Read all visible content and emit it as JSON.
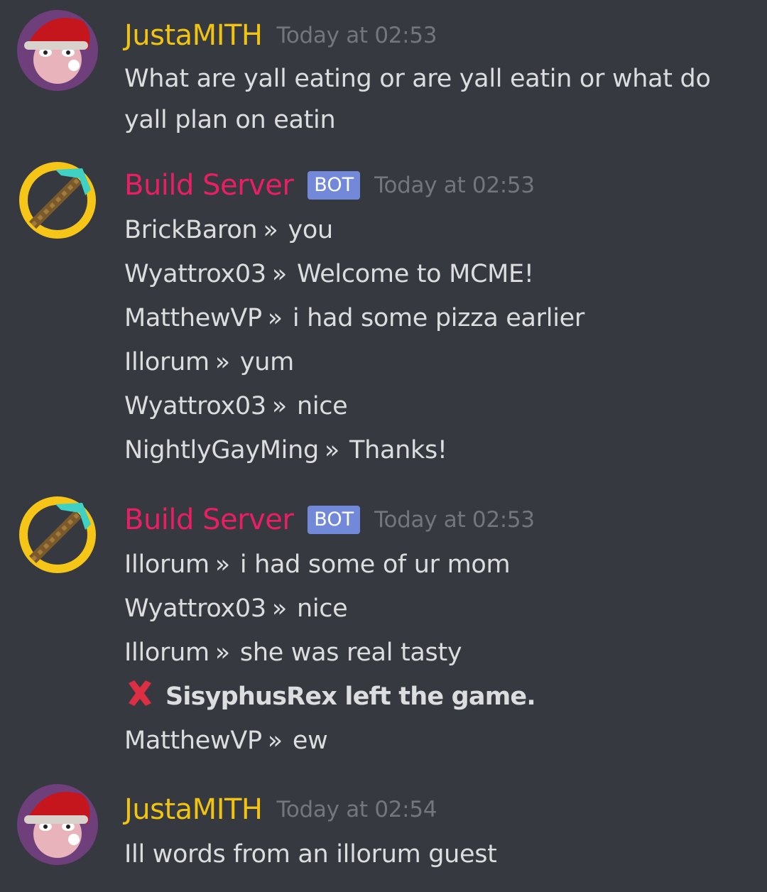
{
  "messages": [
    {
      "author": "JustaMITH",
      "author_color": "#f1c40f",
      "timestamp": "Today at 02:53",
      "avatar_icon": "santa-hat-avatar",
      "text": "What are yall eating or are yall eatin or what do yall plan on eatin"
    },
    {
      "author": "Build Server",
      "author_color": "#e91e63",
      "badge": "BOT",
      "timestamp": "Today at 02:53",
      "avatar_icon": "pickaxe-avatar",
      "lines": [
        {
          "user": "BrickBaron",
          "sep": "»",
          "text": "you"
        },
        {
          "user": "Wyattrox03",
          "sep": "»",
          "text": "Welcome to MCME!"
        },
        {
          "user": "MatthewVP",
          "sep": "»",
          "text": "i had some pizza earlier"
        },
        {
          "user": "Illorum",
          "sep": "»",
          "text": "yum"
        },
        {
          "user": "Wyattrox03",
          "sep": "»",
          "text": "nice"
        },
        {
          "user": "NightlyGayMing",
          "sep": "»",
          "text": "Thanks!"
        }
      ]
    },
    {
      "author": "Build Server",
      "author_color": "#e91e63",
      "badge": "BOT",
      "timestamp": "Today at 02:53",
      "avatar_icon": "pickaxe-avatar",
      "lines": [
        {
          "user": "Illorum",
          "sep": "»",
          "text": "i had some of ur mom"
        },
        {
          "user": "Wyattrox03",
          "sep": "»",
          "text": "nice"
        },
        {
          "user": "Illorum",
          "sep": "»",
          "text": "she was real tasty"
        },
        {
          "system": "SisyphusRex left the game.",
          "icon": "cross-mark-icon"
        },
        {
          "user": "MatthewVP",
          "sep": "»",
          "text": "ew"
        }
      ]
    },
    {
      "author": "JustaMITH",
      "author_color": "#f1c40f",
      "timestamp": "Today at 02:54",
      "avatar_icon": "santa-hat-avatar",
      "text": "Ill words from an illorum guest"
    }
  ]
}
